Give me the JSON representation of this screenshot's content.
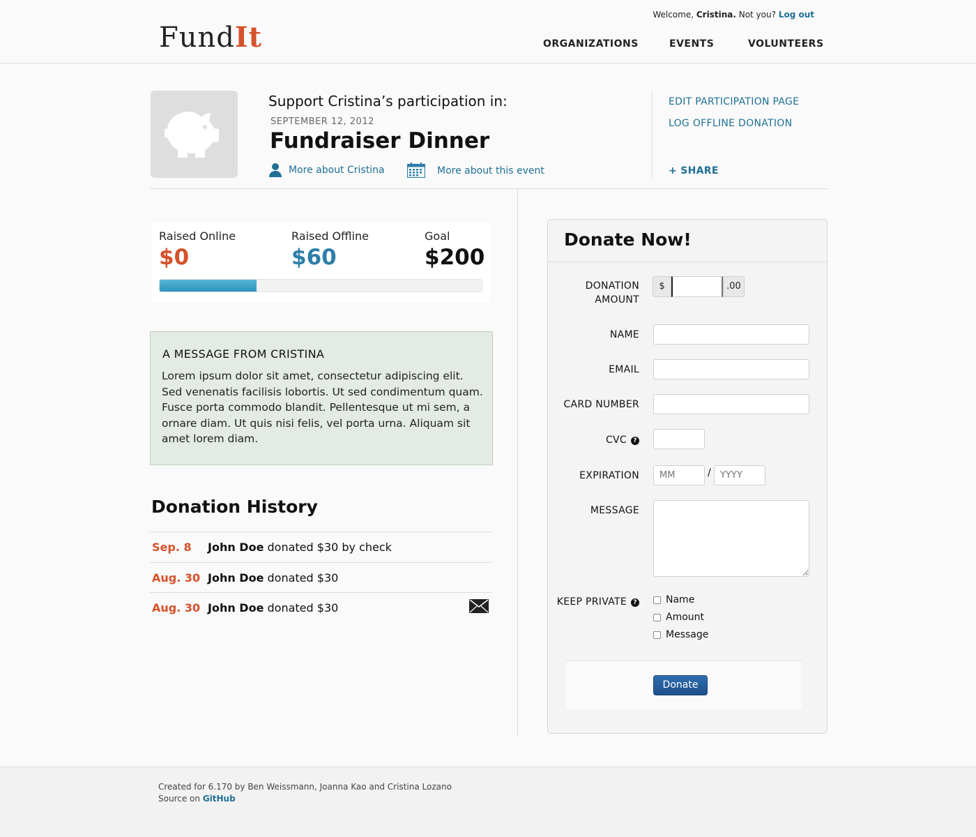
{
  "header": {
    "logo_main": "Fund",
    "logo_accent": "It",
    "welcome_prefix": "Welcome,",
    "welcome_user": "Cristina.",
    "welcome_not_you": "Not you?",
    "logout_label": "Log out",
    "nav": [
      "ORGANIZATIONS",
      "EVENTS",
      "VOLUNTEERS"
    ]
  },
  "event": {
    "support_text": "Support Cristina’s participation in:",
    "date": "SEPTEMBER 12, 2012",
    "name": "Fundraiser Dinner",
    "more_about_person": "More about Cristina",
    "more_about_event": "More about this event"
  },
  "sidebar_links": {
    "edit": "EDIT PARTICIPATION PAGE",
    "log_offline": "LOG OFFLINE DONATION",
    "share": "+ SHARE"
  },
  "progress": {
    "raised_online_label": "Raised Online",
    "raised_online": "$0",
    "raised_offline_label": "Raised Offline",
    "raised_offline": "$60",
    "goal_label": "Goal",
    "goal": "$200",
    "fraction_raised": 0.3
  },
  "message": {
    "title": "A MESSAGE FROM CRISTINA",
    "body": "Lorem ipsum dolor sit amet, consectetur adipiscing elit. Sed venenatis facilisis lobortis. Ut sed condimentum quam. Fusce porta commodo blandit. Pellentesque ut mi sem, a ornare diam. Ut quis nisi felis, vel porta urna. Aliquam sit amet lorem diam."
  },
  "history": {
    "title": "Donation History",
    "rows": [
      {
        "date": "Sep. 8",
        "donor": "John Doe",
        "text": " donated $30 by check",
        "has_message": false
      },
      {
        "date": "Aug. 30",
        "donor": "John Doe",
        "text": " donated $30",
        "has_message": false
      },
      {
        "date": "Aug. 30",
        "donor": "John Doe",
        "text": " donated $30",
        "has_message": true
      }
    ]
  },
  "donate": {
    "title": "Donate Now!",
    "amount_label_1": "DONATION",
    "amount_label_2": "AMOUNT",
    "currency_prefix": "$",
    "cents_suffix": ".00",
    "name_label": "NAME",
    "email_label": "EMAIL",
    "card_label": "CARD NUMBER",
    "cvc_label": "CVC",
    "expiration_label": "EXPIRATION",
    "month_placeholder": "MM",
    "year_placeholder": "YYYY",
    "slash": "/",
    "message_label": "MESSAGE",
    "keep_private_label": "KEEP PRIVATE",
    "private_options": [
      "Name",
      "Amount",
      "Message"
    ],
    "submit_label": "Donate"
  },
  "footer": {
    "credits": "Created for 6.170 by Ben Weissmann, Joanna Kao and Cristina Lozano",
    "source_prefix": "Source on",
    "source_link": "GitHub"
  },
  "icons": {
    "piggy": "piggy-bank-icon",
    "person": "person-icon",
    "calendar": "calendar-icon",
    "help": "question-icon",
    "mail": "envelope-icon"
  },
  "colors": {
    "accent_orange": "#d5522b",
    "link_blue": "#1f6f96",
    "offline_blue": "#2d7fa8",
    "button_blue": "#1d4f8a"
  }
}
